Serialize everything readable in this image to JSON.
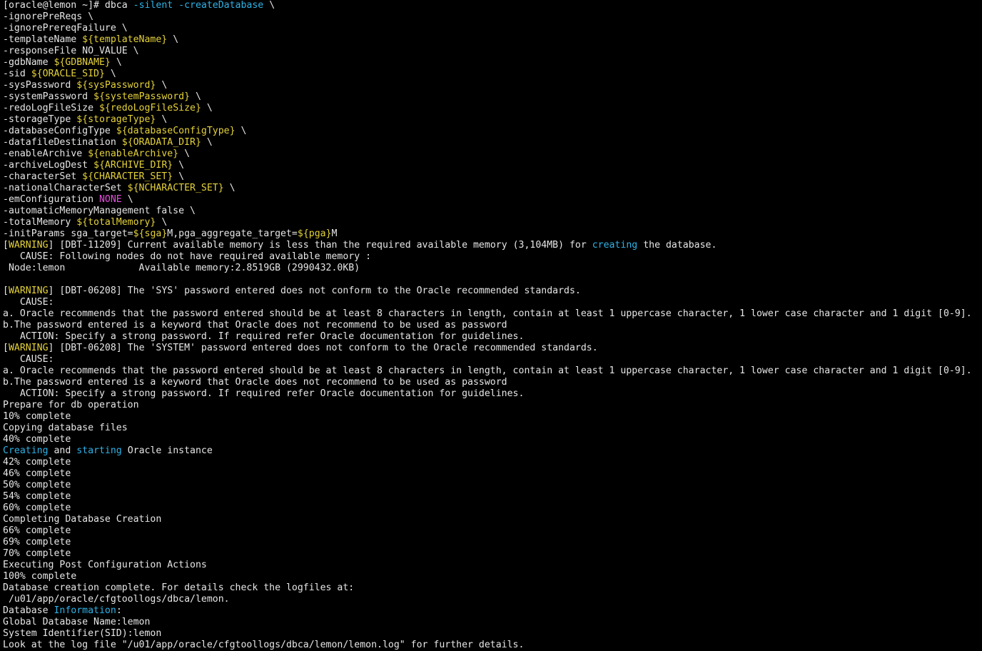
{
  "terminal": {
    "colors": {
      "background": "#000000",
      "default": "#e6e6e6",
      "yellow": "#e5d23a",
      "cyan": "#2fb3e8",
      "magenta": "#e64ee0"
    },
    "lines": [
      [
        {
          "t": "[oracle@lemon ~]# dbca ",
          "c": "default"
        },
        {
          "t": "-silent -createDatabase",
          "c": "cyan"
        },
        {
          "t": " \\",
          "c": "default"
        }
      ],
      [
        {
          "t": "-ignorePreReqs \\",
          "c": "default"
        }
      ],
      [
        {
          "t": "-ignorePrereqFailure \\",
          "c": "default"
        }
      ],
      [
        {
          "t": "-templateName ",
          "c": "default"
        },
        {
          "t": "${templateName}",
          "c": "yellow"
        },
        {
          "t": " \\",
          "c": "default"
        }
      ],
      [
        {
          "t": "-responseFile NO_VALUE \\",
          "c": "default"
        }
      ],
      [
        {
          "t": "-gdbName ",
          "c": "default"
        },
        {
          "t": "${GDBNAME}",
          "c": "yellow"
        },
        {
          "t": " \\",
          "c": "default"
        }
      ],
      [
        {
          "t": "-sid ",
          "c": "default"
        },
        {
          "t": "${ORACLE_SID}",
          "c": "yellow"
        },
        {
          "t": " \\",
          "c": "default"
        }
      ],
      [
        {
          "t": "-sysPassword ",
          "c": "default"
        },
        {
          "t": "${sysPassword}",
          "c": "yellow"
        },
        {
          "t": " \\",
          "c": "default"
        }
      ],
      [
        {
          "t": "-systemPassword ",
          "c": "default"
        },
        {
          "t": "${systemPassword}",
          "c": "yellow"
        },
        {
          "t": " \\",
          "c": "default"
        }
      ],
      [
        {
          "t": "-redoLogFileSize ",
          "c": "default"
        },
        {
          "t": "${redoLogFileSize}",
          "c": "yellow"
        },
        {
          "t": " \\",
          "c": "default"
        }
      ],
      [
        {
          "t": "-storageType ",
          "c": "default"
        },
        {
          "t": "${storageType}",
          "c": "yellow"
        },
        {
          "t": " \\",
          "c": "default"
        }
      ],
      [
        {
          "t": "-databaseConfigType ",
          "c": "default"
        },
        {
          "t": "${databaseConfigType}",
          "c": "yellow"
        },
        {
          "t": " \\",
          "c": "default"
        }
      ],
      [
        {
          "t": "-datafileDestination ",
          "c": "default"
        },
        {
          "t": "${ORADATA_DIR}",
          "c": "yellow"
        },
        {
          "t": " \\",
          "c": "default"
        }
      ],
      [
        {
          "t": "-enableArchive ",
          "c": "default"
        },
        {
          "t": "${enableArchive}",
          "c": "yellow"
        },
        {
          "t": " \\",
          "c": "default"
        }
      ],
      [
        {
          "t": "-archiveLogDest ",
          "c": "default"
        },
        {
          "t": "${ARCHIVE_DIR}",
          "c": "yellow"
        },
        {
          "t": " \\",
          "c": "default"
        }
      ],
      [
        {
          "t": "-characterSet ",
          "c": "default"
        },
        {
          "t": "${CHARACTER_SET}",
          "c": "yellow"
        },
        {
          "t": " \\",
          "c": "default"
        }
      ],
      [
        {
          "t": "-nationalCharacterSet ",
          "c": "default"
        },
        {
          "t": "${NCHARACTER_SET}",
          "c": "yellow"
        },
        {
          "t": " \\",
          "c": "default"
        }
      ],
      [
        {
          "t": "-emConfiguration ",
          "c": "default"
        },
        {
          "t": "NONE",
          "c": "magenta"
        },
        {
          "t": " \\",
          "c": "default"
        }
      ],
      [
        {
          "t": "-automaticMemoryManagement false \\",
          "c": "default"
        }
      ],
      [
        {
          "t": "-totalMemory ",
          "c": "default"
        },
        {
          "t": "${totalMemory}",
          "c": "yellow"
        },
        {
          "t": " \\",
          "c": "default"
        }
      ],
      [
        {
          "t": "-initParams sga_target=",
          "c": "default"
        },
        {
          "t": "${sga}",
          "c": "yellow"
        },
        {
          "t": "M,pga_aggregate_target=",
          "c": "default"
        },
        {
          "t": "${pga}",
          "c": "yellow"
        },
        {
          "t": "M",
          "c": "default"
        }
      ],
      [
        {
          "t": "[",
          "c": "default"
        },
        {
          "t": "WARNING",
          "c": "yellow"
        },
        {
          "t": "] [DBT-11209] Current available memory is less than the required available memory (3,104MB) for ",
          "c": "default"
        },
        {
          "t": "creating",
          "c": "cyan"
        },
        {
          "t": " the database.",
          "c": "default"
        }
      ],
      [
        {
          "t": "   CAUSE: Following nodes do not have required available memory :",
          "c": "default"
        }
      ],
      [
        {
          "t": " Node:lemon             Available memory:2.8519GB (2990432.0KB)",
          "c": "default"
        }
      ],
      [
        {
          "t": "",
          "c": "default"
        }
      ],
      [
        {
          "t": "[",
          "c": "default"
        },
        {
          "t": "WARNING",
          "c": "yellow"
        },
        {
          "t": "] [DBT-06208] The 'SYS' password entered does not conform to the Oracle recommended standards.",
          "c": "default"
        }
      ],
      [
        {
          "t": "   CAUSE:",
          "c": "default"
        }
      ],
      [
        {
          "t": "a. Oracle recommends that the password entered should be at least 8 characters in length, contain at least 1 uppercase character, 1 lower case character and 1 digit [0-9].",
          "c": "default"
        }
      ],
      [
        {
          "t": "b.The password entered is a keyword that Oracle does not recommend to be used as password",
          "c": "default"
        }
      ],
      [
        {
          "t": "   ACTION: Specify a strong password. If required refer Oracle documentation for guidelines.",
          "c": "default"
        }
      ],
      [
        {
          "t": "[",
          "c": "default"
        },
        {
          "t": "WARNING",
          "c": "yellow"
        },
        {
          "t": "] [DBT-06208] The 'SYSTEM' password entered does not conform to the Oracle recommended standards.",
          "c": "default"
        }
      ],
      [
        {
          "t": "   CAUSE:",
          "c": "default"
        }
      ],
      [
        {
          "t": "a. Oracle recommends that the password entered should be at least 8 characters in length, contain at least 1 uppercase character, 1 lower case character and 1 digit [0-9].",
          "c": "default"
        }
      ],
      [
        {
          "t": "b.The password entered is a keyword that Oracle does not recommend to be used as password",
          "c": "default"
        }
      ],
      [
        {
          "t": "   ACTION: Specify a strong password. If required refer Oracle documentation for guidelines.",
          "c": "default"
        }
      ],
      [
        {
          "t": "Prepare for db operation",
          "c": "default"
        }
      ],
      [
        {
          "t": "10% complete",
          "c": "default"
        }
      ],
      [
        {
          "t": "Copying database files",
          "c": "default"
        }
      ],
      [
        {
          "t": "40% complete",
          "c": "default"
        }
      ],
      [
        {
          "t": "Creating",
          "c": "cyan"
        },
        {
          "t": " and ",
          "c": "default"
        },
        {
          "t": "starting",
          "c": "cyan"
        },
        {
          "t": " Oracle instance",
          "c": "default"
        }
      ],
      [
        {
          "t": "42% complete",
          "c": "default"
        }
      ],
      [
        {
          "t": "46% complete",
          "c": "default"
        }
      ],
      [
        {
          "t": "50% complete",
          "c": "default"
        }
      ],
      [
        {
          "t": "54% complete",
          "c": "default"
        }
      ],
      [
        {
          "t": "60% complete",
          "c": "default"
        }
      ],
      [
        {
          "t": "Completing Database Creation",
          "c": "default"
        }
      ],
      [
        {
          "t": "66% complete",
          "c": "default"
        }
      ],
      [
        {
          "t": "69% complete",
          "c": "default"
        }
      ],
      [
        {
          "t": "70% complete",
          "c": "default"
        }
      ],
      [
        {
          "t": "Executing Post Configuration Actions",
          "c": "default"
        }
      ],
      [
        {
          "t": "100% complete",
          "c": "default"
        }
      ],
      [
        {
          "t": "Database creation complete. For details check the logfiles at:",
          "c": "default"
        }
      ],
      [
        {
          "t": " /u01/app/oracle/cfgtoollogs/dbca/lemon.",
          "c": "default"
        }
      ],
      [
        {
          "t": "Database ",
          "c": "default"
        },
        {
          "t": "Information",
          "c": "cyan"
        },
        {
          "t": ":",
          "c": "default"
        }
      ],
      [
        {
          "t": "Global Database Name:lemon",
          "c": "default"
        }
      ],
      [
        {
          "t": "System Identifier(SID):lemon",
          "c": "default"
        }
      ],
      [
        {
          "t": "Look at the log file \"/u01/app/oracle/cfgtoollogs/dbca/lemon/lemon.log\" for further details.",
          "c": "default"
        }
      ]
    ]
  }
}
